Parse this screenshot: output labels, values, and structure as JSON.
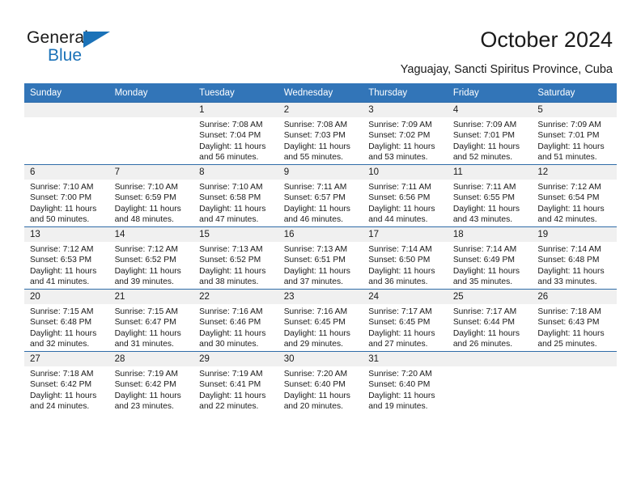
{
  "brand": {
    "name_part1": "General",
    "name_part2": "Blue",
    "accent_color": "#1b72b8"
  },
  "header": {
    "title": "October 2024",
    "subtitle": "Yaguajay, Sancti Spiritus Province, Cuba"
  },
  "calendar": {
    "header_color": "#3275b8",
    "weekday_headers": [
      "Sunday",
      "Monday",
      "Tuesday",
      "Wednesday",
      "Thursday",
      "Friday",
      "Saturday"
    ],
    "weeks": [
      [
        {
          "day": "",
          "empty": true
        },
        {
          "day": "",
          "empty": true
        },
        {
          "day": "1",
          "sunrise": "Sunrise: 7:08 AM",
          "sunset": "Sunset: 7:04 PM",
          "daylight": "Daylight: 11 hours and 56 minutes."
        },
        {
          "day": "2",
          "sunrise": "Sunrise: 7:08 AM",
          "sunset": "Sunset: 7:03 PM",
          "daylight": "Daylight: 11 hours and 55 minutes."
        },
        {
          "day": "3",
          "sunrise": "Sunrise: 7:09 AM",
          "sunset": "Sunset: 7:02 PM",
          "daylight": "Daylight: 11 hours and 53 minutes."
        },
        {
          "day": "4",
          "sunrise": "Sunrise: 7:09 AM",
          "sunset": "Sunset: 7:01 PM",
          "daylight": "Daylight: 11 hours and 52 minutes."
        },
        {
          "day": "5",
          "sunrise": "Sunrise: 7:09 AM",
          "sunset": "Sunset: 7:01 PM",
          "daylight": "Daylight: 11 hours and 51 minutes."
        }
      ],
      [
        {
          "day": "6",
          "sunrise": "Sunrise: 7:10 AM",
          "sunset": "Sunset: 7:00 PM",
          "daylight": "Daylight: 11 hours and 50 minutes."
        },
        {
          "day": "7",
          "sunrise": "Sunrise: 7:10 AM",
          "sunset": "Sunset: 6:59 PM",
          "daylight": "Daylight: 11 hours and 48 minutes."
        },
        {
          "day": "8",
          "sunrise": "Sunrise: 7:10 AM",
          "sunset": "Sunset: 6:58 PM",
          "daylight": "Daylight: 11 hours and 47 minutes."
        },
        {
          "day": "9",
          "sunrise": "Sunrise: 7:11 AM",
          "sunset": "Sunset: 6:57 PM",
          "daylight": "Daylight: 11 hours and 46 minutes."
        },
        {
          "day": "10",
          "sunrise": "Sunrise: 7:11 AM",
          "sunset": "Sunset: 6:56 PM",
          "daylight": "Daylight: 11 hours and 44 minutes."
        },
        {
          "day": "11",
          "sunrise": "Sunrise: 7:11 AM",
          "sunset": "Sunset: 6:55 PM",
          "daylight": "Daylight: 11 hours and 43 minutes."
        },
        {
          "day": "12",
          "sunrise": "Sunrise: 7:12 AM",
          "sunset": "Sunset: 6:54 PM",
          "daylight": "Daylight: 11 hours and 42 minutes."
        }
      ],
      [
        {
          "day": "13",
          "sunrise": "Sunrise: 7:12 AM",
          "sunset": "Sunset: 6:53 PM",
          "daylight": "Daylight: 11 hours and 41 minutes."
        },
        {
          "day": "14",
          "sunrise": "Sunrise: 7:12 AM",
          "sunset": "Sunset: 6:52 PM",
          "daylight": "Daylight: 11 hours and 39 minutes."
        },
        {
          "day": "15",
          "sunrise": "Sunrise: 7:13 AM",
          "sunset": "Sunset: 6:52 PM",
          "daylight": "Daylight: 11 hours and 38 minutes."
        },
        {
          "day": "16",
          "sunrise": "Sunrise: 7:13 AM",
          "sunset": "Sunset: 6:51 PM",
          "daylight": "Daylight: 11 hours and 37 minutes."
        },
        {
          "day": "17",
          "sunrise": "Sunrise: 7:14 AM",
          "sunset": "Sunset: 6:50 PM",
          "daylight": "Daylight: 11 hours and 36 minutes."
        },
        {
          "day": "18",
          "sunrise": "Sunrise: 7:14 AM",
          "sunset": "Sunset: 6:49 PM",
          "daylight": "Daylight: 11 hours and 35 minutes."
        },
        {
          "day": "19",
          "sunrise": "Sunrise: 7:14 AM",
          "sunset": "Sunset: 6:48 PM",
          "daylight": "Daylight: 11 hours and 33 minutes."
        }
      ],
      [
        {
          "day": "20",
          "sunrise": "Sunrise: 7:15 AM",
          "sunset": "Sunset: 6:48 PM",
          "daylight": "Daylight: 11 hours and 32 minutes."
        },
        {
          "day": "21",
          "sunrise": "Sunrise: 7:15 AM",
          "sunset": "Sunset: 6:47 PM",
          "daylight": "Daylight: 11 hours and 31 minutes."
        },
        {
          "day": "22",
          "sunrise": "Sunrise: 7:16 AM",
          "sunset": "Sunset: 6:46 PM",
          "daylight": "Daylight: 11 hours and 30 minutes."
        },
        {
          "day": "23",
          "sunrise": "Sunrise: 7:16 AM",
          "sunset": "Sunset: 6:45 PM",
          "daylight": "Daylight: 11 hours and 29 minutes."
        },
        {
          "day": "24",
          "sunrise": "Sunrise: 7:17 AM",
          "sunset": "Sunset: 6:45 PM",
          "daylight": "Daylight: 11 hours and 27 minutes."
        },
        {
          "day": "25",
          "sunrise": "Sunrise: 7:17 AM",
          "sunset": "Sunset: 6:44 PM",
          "daylight": "Daylight: 11 hours and 26 minutes."
        },
        {
          "day": "26",
          "sunrise": "Sunrise: 7:18 AM",
          "sunset": "Sunset: 6:43 PM",
          "daylight": "Daylight: 11 hours and 25 minutes."
        }
      ],
      [
        {
          "day": "27",
          "sunrise": "Sunrise: 7:18 AM",
          "sunset": "Sunset: 6:42 PM",
          "daylight": "Daylight: 11 hours and 24 minutes."
        },
        {
          "day": "28",
          "sunrise": "Sunrise: 7:19 AM",
          "sunset": "Sunset: 6:42 PM",
          "daylight": "Daylight: 11 hours and 23 minutes."
        },
        {
          "day": "29",
          "sunrise": "Sunrise: 7:19 AM",
          "sunset": "Sunset: 6:41 PM",
          "daylight": "Daylight: 11 hours and 22 minutes."
        },
        {
          "day": "30",
          "sunrise": "Sunrise: 7:20 AM",
          "sunset": "Sunset: 6:40 PM",
          "daylight": "Daylight: 11 hours and 20 minutes."
        },
        {
          "day": "31",
          "sunrise": "Sunrise: 7:20 AM",
          "sunset": "Sunset: 6:40 PM",
          "daylight": "Daylight: 11 hours and 19 minutes."
        },
        {
          "day": "",
          "empty": true
        },
        {
          "day": "",
          "empty": true
        }
      ]
    ]
  }
}
